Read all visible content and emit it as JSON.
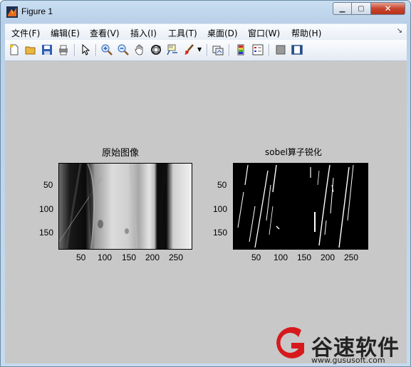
{
  "window": {
    "title": "Figure 1"
  },
  "menu": [
    "文件(F)",
    "编辑(E)",
    "查看(V)",
    "插入(I)",
    "工具(T)",
    "桌面(D)",
    "窗口(W)",
    "帮助(H)"
  ],
  "toolbar": {
    "icons": [
      "new-figure-icon",
      "open-file-icon",
      "save-icon",
      "print-icon",
      "pointer-icon",
      "zoom-in-icon",
      "zoom-out-icon",
      "pan-hand-icon",
      "rotate-3d-icon",
      "data-cursor-icon",
      "brush-icon",
      "link-plot-icon",
      "colorbar-icon",
      "legend-icon",
      "hide-plot-tools-icon",
      "show-plot-tools-icon"
    ]
  },
  "axes": [
    {
      "title": "原始图像",
      "yticks": [
        "50",
        "100",
        "150"
      ],
      "xticks": [
        "50",
        "100",
        "150",
        "200",
        "250"
      ]
    },
    {
      "title": "sobel算子锐化",
      "yticks": [
        "50",
        "100",
        "150"
      ],
      "xticks": [
        "50",
        "100",
        "150",
        "200",
        "250"
      ]
    }
  ],
  "watermark": {
    "brand": "谷速软件",
    "url": "www.gususoft.com"
  }
}
